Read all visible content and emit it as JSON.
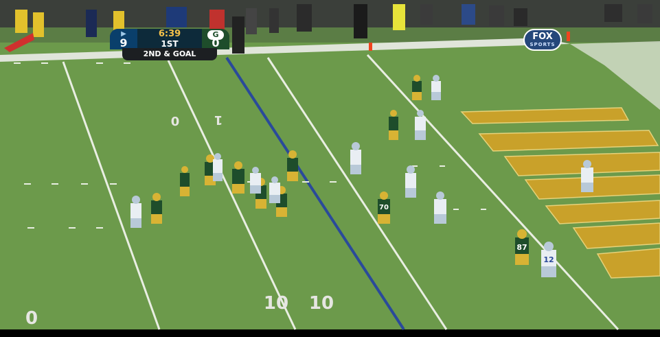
{
  "scorebug": {
    "away_score": "9",
    "home_score": "0",
    "clock": "6:39",
    "quarter": "1ST",
    "down_distance": "2ND & GOAL",
    "away_logo": "lions-logo",
    "home_logo": "packers-g-logo",
    "away_color": "#0a3f6b",
    "home_color": "#1e4d2b",
    "clock_color": "#f6c24a"
  },
  "network": {
    "name": "FOX",
    "sub": "SPORTS",
    "color": "#25477a"
  },
  "field": {
    "grass_color": "#6c9a4b",
    "endzone_text_color": "#c9a12a",
    "yard_numbers": [
      "10",
      "10",
      "0"
    ]
  },
  "players": {
    "home_jersey": "#1e4d2b",
    "home_pants": "#d8b334",
    "away_jersey": "#e9eef3",
    "away_pants": "#b8c9d8",
    "numbers": [
      "87",
      "12",
      "70"
    ]
  }
}
